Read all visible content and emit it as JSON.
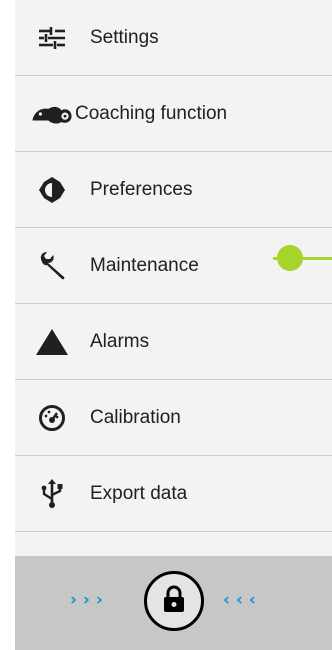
{
  "menu": {
    "items": [
      {
        "label": "Settings",
        "icon": "sliders-icon"
      },
      {
        "label": "Coaching function",
        "icon": "chameleon-icon"
      },
      {
        "label": "Preferences",
        "icon": "brightness-icon"
      },
      {
        "label": "Maintenance",
        "icon": "wrench-icon"
      },
      {
        "label": "Alarms",
        "icon": "warning-triangle-icon"
      },
      {
        "label": "Calibration",
        "icon": "gauge-icon"
      },
      {
        "label": "Export data",
        "icon": "usb-icon"
      }
    ]
  },
  "lock_bar": {
    "left_chevrons": "› › ›",
    "right_chevrons": "‹ ‹ ‹",
    "lock_icon": "padlock-icon"
  },
  "colors": {
    "accent": "#a7d42a",
    "chevron": "#1d8fe0",
    "menu_bg": "#f3f3f3",
    "lock_bar_bg": "#c7c7c7"
  }
}
